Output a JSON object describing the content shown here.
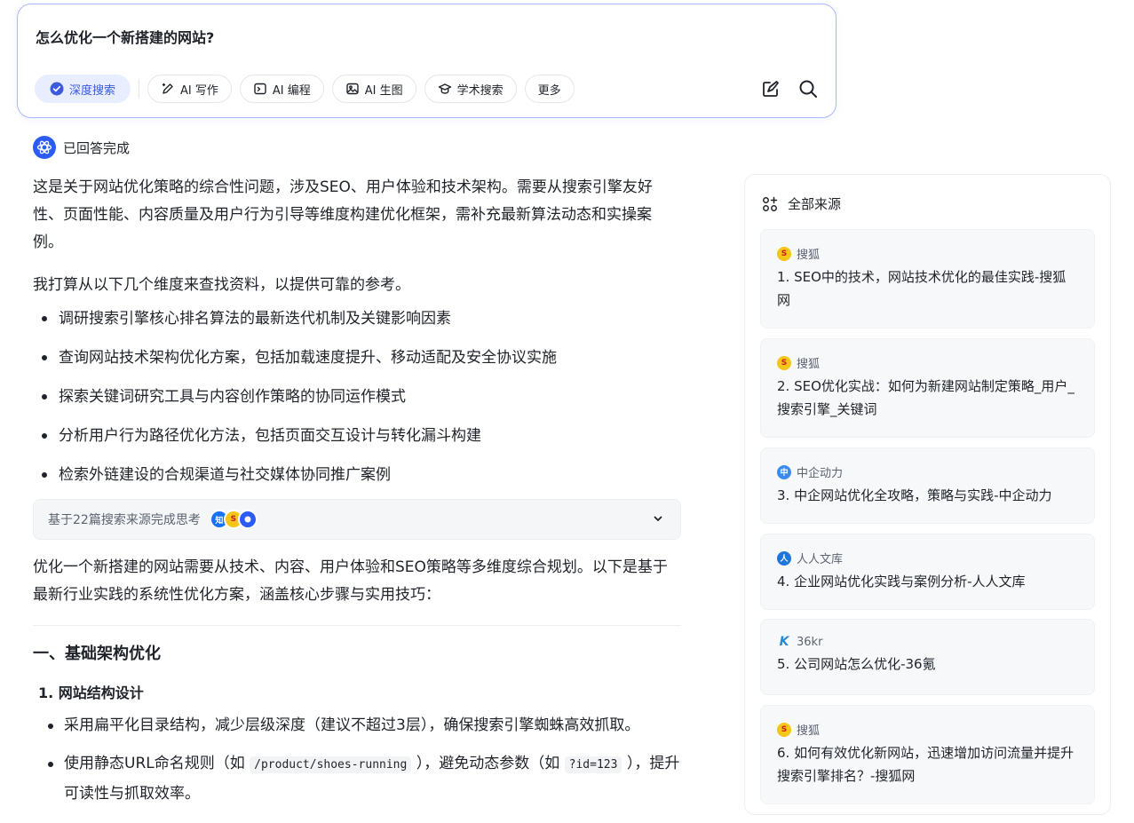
{
  "search": {
    "query": "怎么优化一个新搭建的网站?",
    "chips": {
      "deep_search": "深度搜索",
      "ai_write": "AI 写作",
      "ai_code": "AI 编程",
      "ai_image": "AI 生图",
      "academic": "学术搜索",
      "more": "更多"
    }
  },
  "status": {
    "text": "已回答完成"
  },
  "answer": {
    "intro": "这是关于网站优化策略的综合性问题，涉及SEO、用户体验和技术架构。需要从搜索引擎友好性、页面性能、内容质量及用户行为引导等维度构建优化框架，需补充最新算法动态和实操案例。",
    "plan_intro": "我打算从以下几个维度来查找资料，以提供可靠的参考。",
    "plan_items": [
      "调研搜索引擎核心排名算法的最新迭代机制及关键影响因素",
      "查询网站技术架构优化方案，包括加载速度提升、移动适配及安全协议实施",
      "探索关键词研究工具与内容创作策略的协同运作模式",
      "分析用户行为路径优化方法，包括页面交互设计与转化漏斗构建",
      "检索外链建设的合规渠道与社交媒体协同推广案例"
    ],
    "sources_summary": "基于22篇搜索来源完成思考",
    "source_avatars": [
      "知",
      "S",
      ""
    ],
    "summary": "优化一个新搭建的网站需要从技术、内容、用户体验和SEO策略等多维度综合规划。以下是基于最新行业实践的系统性优化方案，涵盖核心步骤与实用技巧：",
    "section_title": "一、基础架构优化",
    "subsection_title": "1. 网站结构设计",
    "bullet1": "采用扁平化目录结构，减少层级深度（建议不超过3层），确保搜索引擎蜘蛛高效抓取。",
    "bullet2_a": "使用静态URL命名规则（如 ",
    "bullet2_code1": "/product/shoes-running",
    "bullet2_b": " ），避免动态参数（如 ",
    "bullet2_code2": "?id=123",
    "bullet2_c": " ），提升可读性与抓取效率。"
  },
  "sources_panel": {
    "title": "全部来源",
    "cards": [
      {
        "site": "搜狐",
        "icon": "sohu-icon",
        "title": "1. SEO中的技术，网站技术优化的最佳实践-搜狐网"
      },
      {
        "site": "搜狐",
        "icon": "sohu-icon",
        "title": "2. SEO优化实战：如何为新建网站制定策略_用户_搜索引擎_关键词"
      },
      {
        "site": "中企动力",
        "icon": "zhongqi-icon",
        "title": "3. 中企网站优化全攻略，策略与实践-中企动力"
      },
      {
        "site": "人人文库",
        "icon": "renren-icon",
        "title": "4. 企业网站优化实践与案例分析-人人文库"
      },
      {
        "site": "36kr",
        "icon": "36kr-icon",
        "title": "5. 公司网站怎么优化-36氪"
      },
      {
        "site": "搜狐",
        "icon": "sohu-icon",
        "title": "6. 如何有效优化新网站，迅速增加访问流量并提升搜索引擎排名？-搜狐网"
      }
    ]
  },
  "colors": {
    "accent": "#2b5cf5",
    "chip_active_bg": "#e8edff",
    "border": "#a9b8ff"
  }
}
